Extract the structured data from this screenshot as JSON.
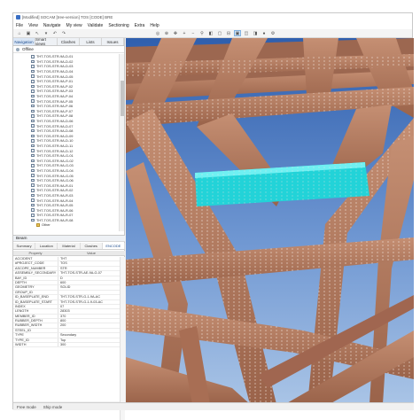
{
  "window": {
    "title": "[Modified] SOCAM [tree-version] TOS [CODE] BRE"
  },
  "menu": [
    "File",
    "View",
    "Navigate",
    "My view",
    "Validate",
    "Sectioning",
    "Extra",
    "Help"
  ],
  "left_panel": {
    "tabs": [
      {
        "label": "Navigation",
        "active": true
      },
      {
        "label": "Smart views",
        "active": false
      },
      {
        "label": "Clashes",
        "active": false
      },
      {
        "label": "Lists",
        "active": false
      },
      {
        "label": "Issues",
        "active": false
      }
    ],
    "status": "Offline",
    "tree_items": [
      "THT-TOS-STR-9A-D-01",
      "THT-TOS-STR-9A-D-02",
      "THT-TOS-STR-9A-D-03",
      "THT-TOS-STR-9A-D-04",
      "THT-TOS-STR-9A-D-05",
      "THT-TOS-STR-9A-P-01",
      "THT-TOS-STR-9A-P-02",
      "THT-TOS-STR-9A-P-03",
      "THT-TOS-STR-9A-P-04",
      "THT-TOS-STR-9A-P-05",
      "THT-TOS-STR-9A-P-06",
      "THT-TOS-STR-9A-P-07",
      "THT-TOS-STR-9A-P-08",
      "THT-TOS-STR-9A-D-06",
      "THT-TOS-STR-9A-D-07",
      "THT-TOS-STR-9A-D-08",
      "THT-TOS-STR-9A-D-09",
      "THT-TOS-STR-9A-D-10",
      "THT-TOS-STR-9A-D-11",
      "THT-TOS-STR-9A-D-12",
      "THT-TOS-STR-9A-G-01",
      "THT-TOS-STR-9A-G-02",
      "THT-TOS-STR-9A-G-03",
      "THT-TOS-STR-9A-G-04",
      "THT-TOS-STR-9A-G-05",
      "THT-TOS-STR-9A-G-06",
      "THT-TOS-STR-9A-R-01",
      "THT-TOS-STR-9A-R-02",
      "THT-TOS-STR-9A-R-03",
      "THT-TOS-STR-9A-R-04",
      "THT-TOS-STR-9A-R-05",
      "THT-TOS-STR-9A-R-06",
      "THT-TOS-STR-9A-R-07",
      "THT-TOS-STR-9A-R-08"
    ],
    "tree_folder": "Other"
  },
  "properties": {
    "title": "Beam",
    "tabs": [
      {
        "label": "Summary",
        "active": false
      },
      {
        "label": "Location",
        "active": false
      },
      {
        "label": "Material",
        "active": false
      },
      {
        "label": "Clashes",
        "active": false
      },
      {
        "label": "ENCODE",
        "active": true
      }
    ],
    "columns": {
      "property": "Property",
      "value": "Value"
    },
    "rows": [
      {
        "k": "ACCIDENT",
        "v": "THT"
      },
      {
        "k": "#PROJECT_CODE",
        "v": "TOS"
      },
      {
        "k": "ASCOPE_NUMBER",
        "v": "STR"
      },
      {
        "k": "ASSEMBLY_SECONDARY",
        "v": "THT-TOS-STR-AE-9A-G-07"
      },
      {
        "k": "BAY_ID",
        "v": "D"
      },
      {
        "k": "DEPTH",
        "v": "600"
      },
      {
        "k": "GEOMETRY",
        "v": "SOLID"
      },
      {
        "k": "GROUP_ID",
        "v": ""
      },
      {
        "k": "ID_BASEPLATE_END",
        "v": "THT-TOS-STR-G-1-9A-AC"
      },
      {
        "k": "ID_BASEPLATE_START",
        "v": "THT-TOS-STR-G-1-9-03-AC"
      },
      {
        "k": "INDEX",
        "v": "07"
      },
      {
        "k": "LENGTH",
        "v": "28303"
      },
      {
        "k": "MEMBER_ID",
        "v": "370"
      },
      {
        "k": "RUBBER_DEPTH",
        "v": "800"
      },
      {
        "k": "RUBBER_WIDTH",
        "v": "200"
      },
      {
        "k": "STEEL_ID",
        "v": ""
      },
      {
        "k": "TYPE",
        "v": "Secondary"
      },
      {
        "k": "TYPE_ID",
        "v": "Top"
      },
      {
        "k": "WIDTH",
        "v": "300"
      }
    ]
  },
  "statusbar": {
    "left": "Free mode",
    "right": "Ship mode"
  },
  "colors": {
    "beam": "#b37a5e",
    "beam_dark": "#8e5a44",
    "selected": "#22d3d8",
    "sky_top": "#2f5fae",
    "sky_bottom": "#a9c4e6"
  }
}
